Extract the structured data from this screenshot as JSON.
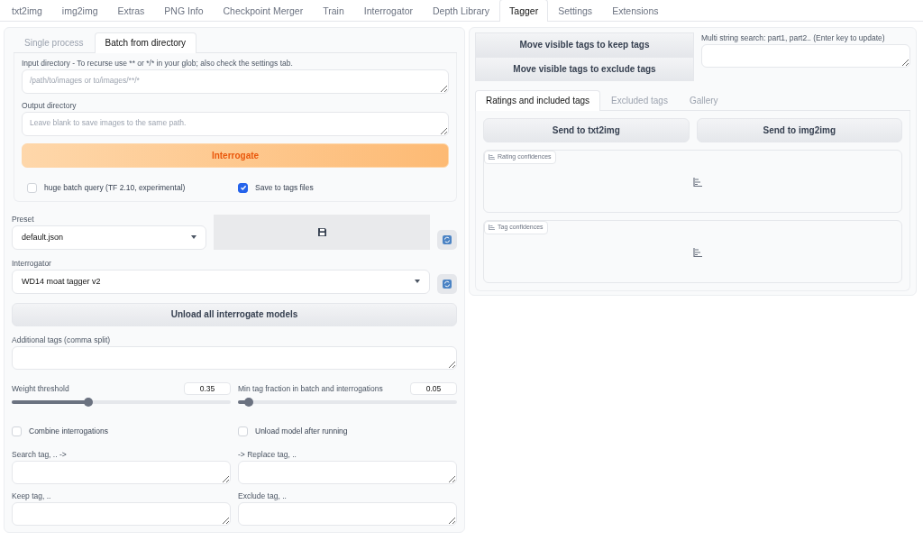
{
  "top_tabs": [
    {
      "label": "txt2img",
      "selected": false
    },
    {
      "label": "img2img",
      "selected": false
    },
    {
      "label": "Extras",
      "selected": false
    },
    {
      "label": "PNG Info",
      "selected": false
    },
    {
      "label": "Checkpoint Merger",
      "selected": false
    },
    {
      "label": "Train",
      "selected": false
    },
    {
      "label": "Interrogator",
      "selected": false
    },
    {
      "label": "Depth Library",
      "selected": false
    },
    {
      "label": "Tagger",
      "selected": true
    },
    {
      "label": "Settings",
      "selected": false
    },
    {
      "label": "Extensions",
      "selected": false
    }
  ],
  "mode_tabs": [
    {
      "label": "Single process",
      "selected": false
    },
    {
      "label": "Batch from directory",
      "selected": true
    }
  ],
  "batch": {
    "input_dir": {
      "label": "Input directory - To recurse use ** or */* in your glob; also check the settings tab.",
      "placeholder": "/path/to/images or to/images/**/*"
    },
    "output_dir": {
      "label": "Output directory",
      "placeholder": "Leave blank to save images to the same path."
    },
    "interrogate_button": "Interrogate",
    "options": [
      {
        "label": "huge batch query (TF 2.10, experimental)",
        "checked": false
      },
      {
        "label": "Save to tags files",
        "checked": true
      }
    ]
  },
  "preset": {
    "label": "Preset",
    "value": "default.json"
  },
  "interrogator": {
    "label": "Interrogator",
    "value": "WD14 moat tagger v2"
  },
  "unload_button": "Unload all interrogate models",
  "additional_tags": {
    "label": "Additional tags (comma split)"
  },
  "sliders": [
    {
      "label": "Weight threshold",
      "reading": "0.35",
      "level": 0.35
    },
    {
      "label": "Min tag fraction in batch and interrogations",
      "reading": "0.05",
      "level": 0.05
    }
  ],
  "toggles": [
    {
      "label": "Combine interrogations",
      "checked": false
    },
    {
      "label": "Unload model after running",
      "checked": false
    }
  ],
  "tag_fields": [
    {
      "label": "Search tag, .. ->"
    },
    {
      "label": "-> Replace tag, .."
    },
    {
      "label": "Keep tag, .."
    },
    {
      "label": "Exclude tag, .."
    }
  ],
  "right": {
    "move_buttons": [
      "Move visible tags to keep tags",
      "Move visible tags to exclude tags"
    ],
    "search": {
      "label": "Multi string search: part1, part2.. (Enter key to update)"
    },
    "result_tabs": [
      {
        "label": "Ratings and included tags",
        "selected": true
      },
      {
        "label": "Excluded tags",
        "selected": false
      },
      {
        "label": "Gallery",
        "selected": false
      }
    ],
    "send_buttons": [
      "Send to txt2img",
      "Send to img2img"
    ],
    "confidence_panels": [
      {
        "label": "Rating confidences"
      },
      {
        "label": "Tag confidences"
      }
    ]
  }
}
